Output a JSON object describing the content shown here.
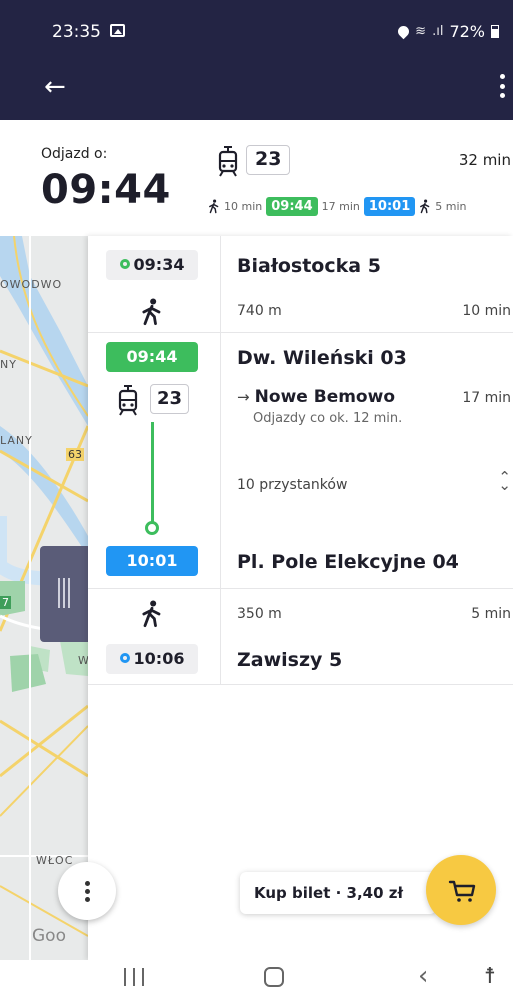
{
  "status_bar": {
    "time": "23:35",
    "battery": "72%",
    "icons": [
      "gallery-icon",
      "location-icon",
      "wifi-call-icon",
      "signal-icon",
      "battery-icon"
    ]
  },
  "app_bar": {
    "back_icon": "arrow-left-icon",
    "more_icon": "more-vertical-icon"
  },
  "summary": {
    "departure_label": "Odjazd o:",
    "departure_time": "09:44",
    "line": "23",
    "total_duration": "32 min",
    "timeline": {
      "walk_before": "10 min",
      "board_time": "09:44",
      "ride": "17 min",
      "alight_time": "10:01",
      "walk_after": "5 min"
    }
  },
  "map": {
    "labels": [
      "OWODWO",
      "NY",
      "LANY",
      "63",
      "7",
      "W",
      "WŁOC",
      "Goo"
    ],
    "menu_icon": "more-vertical-icon",
    "drag_icon": "drag-handle-icon"
  },
  "route": {
    "start": {
      "time": "09:34",
      "name": "Białostocka 5"
    },
    "walk1": {
      "distance": "740 m",
      "duration": "10 min"
    },
    "board": {
      "time": "09:44",
      "name": "Dw. Wileński 03"
    },
    "ride": {
      "line": "23",
      "direction_arrow": "→",
      "direction": "Nowe Bemowo",
      "duration": "17 min",
      "frequency": "Odjazdy co ok. 12 min.",
      "stops_count": "10 przystanków"
    },
    "alight": {
      "time": "10:01",
      "name": "Pl. Pole Elekcyjne 04"
    },
    "walk2": {
      "distance": "350 m",
      "duration": "5 min"
    },
    "end": {
      "time": "10:06",
      "name": "Zawiszy 5"
    }
  },
  "ticket": {
    "buy_label": "Kup bilet · 3,40 zł",
    "cart_icon": "cart-icon"
  },
  "colors": {
    "app_bar": "#232444",
    "green": "#3dbd5d",
    "blue": "#2196f3",
    "fab_yellow": "#f7c942"
  }
}
